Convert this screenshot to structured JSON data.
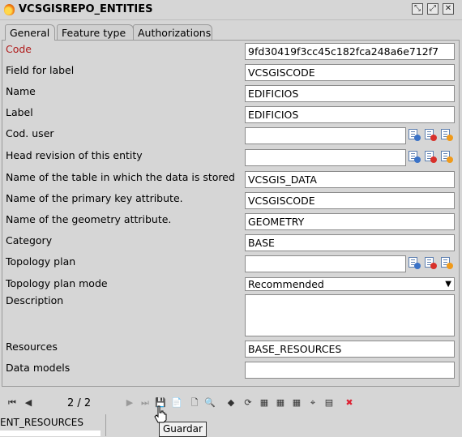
{
  "window": {
    "title": "VCSGISREPO_ENTITIES"
  },
  "tabs": [
    {
      "label": "General"
    },
    {
      "label": "Feature type"
    },
    {
      "label": "Authorizations"
    }
  ],
  "form": {
    "code": {
      "label": "Code",
      "value": "9fd30419f3cc45c182fca248a6e712f7"
    },
    "field_for_label": {
      "label": "Field for label",
      "value": "VCSGISCODE"
    },
    "name": {
      "label": "Name",
      "value": "EDIFICIOS"
    },
    "label": {
      "label": "Label",
      "value": "EDIFICIOS"
    },
    "cod_user": {
      "label": "Cod. user",
      "value": ""
    },
    "head_revision": {
      "label": "Head revision of this entity",
      "value": ""
    },
    "table_name": {
      "label": "Name of the table in which the data is stored",
      "value": "VCSGIS_DATA"
    },
    "pk_attribute": {
      "label": "Name of the primary key attribute.",
      "value": "VCSGISCODE"
    },
    "geometry_attribute": {
      "label": "Name of the geometry attribute.",
      "value": "GEOMETRY"
    },
    "category": {
      "label": "Category",
      "value": "BASE"
    },
    "topology_plan": {
      "label": "Topology plan",
      "value": ""
    },
    "topology_plan_mode": {
      "label": "Topology plan mode",
      "value": "Recommended"
    },
    "description": {
      "label": "Description",
      "value": ""
    },
    "resources": {
      "label": "Resources",
      "value": "BASE_RESOURCES"
    },
    "data_models": {
      "label": "Data models",
      "value": ""
    }
  },
  "navigation": {
    "page_counter": "2 / 2"
  },
  "bottom": {
    "resources_text": "ENT_RESOURCES",
    "tooltip": "Guardar"
  }
}
